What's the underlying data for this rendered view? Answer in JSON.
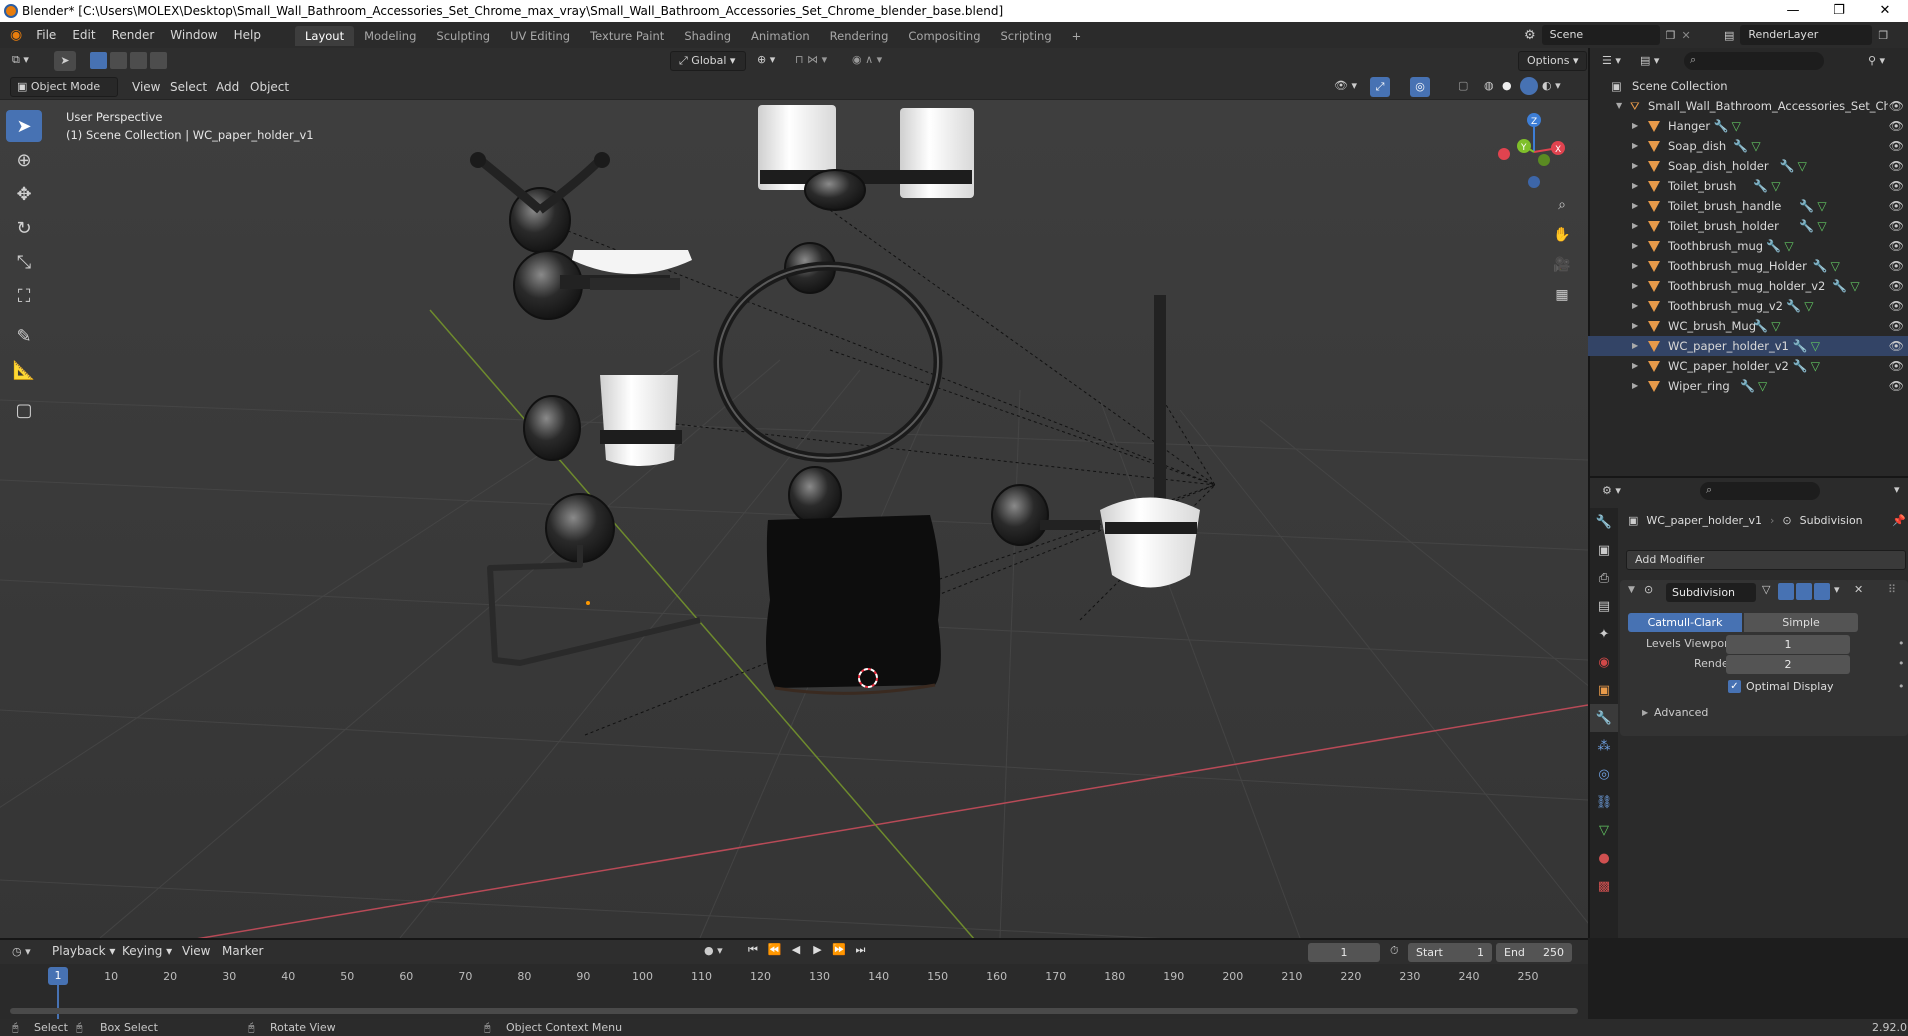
{
  "window": {
    "title": "Blender* [C:\\Users\\MOLEX\\Desktop\\Small_Wall_Bathroom_Accessories_Set_Chrome_max_vray\\Small_Wall_Bathroom_Accessories_Set_Chrome_blender_base.blend]",
    "minimize": "—",
    "restore": "❐",
    "close": "✕"
  },
  "menu": [
    "File",
    "Edit",
    "Render",
    "Window",
    "Help"
  ],
  "workspaces": [
    "Layout",
    "Modeling",
    "Sculpting",
    "UV Editing",
    "Texture Paint",
    "Shading",
    "Animation",
    "Rendering",
    "Compositing",
    "Scripting"
  ],
  "workspace_add": "+",
  "scene": "Scene",
  "view_layer": "RenderLayer",
  "header": {
    "transform_orientation": "Global",
    "options": "Options"
  },
  "viewport_header": {
    "mode": "Object Mode",
    "menus": [
      "View",
      "Select",
      "Add",
      "Object"
    ]
  },
  "viewport": {
    "perspective_label": "User Perspective",
    "collection_label": "(1) Scene Collection | WC_paper_holder_v1",
    "gizmo": {
      "z": "Z",
      "y": "Y",
      "x": "X"
    }
  },
  "outliner": {
    "root": "Scene Collection",
    "collection": "Small_Wall_Bathroom_Accessories_Set_Chro",
    "items": [
      {
        "name": "Hanger",
        "selected": false
      },
      {
        "name": "Soap_dish",
        "selected": false
      },
      {
        "name": "Soap_dish_holder",
        "selected": false
      },
      {
        "name": "Toilet_brush",
        "selected": false
      },
      {
        "name": "Toilet_brush_handle",
        "selected": false
      },
      {
        "name": "Toilet_brush_holder",
        "selected": false
      },
      {
        "name": "Toothbrush_mug",
        "selected": false
      },
      {
        "name": "Toothbrush_mug_Holder",
        "selected": false
      },
      {
        "name": "Toothbrush_mug_holder_v2",
        "selected": false
      },
      {
        "name": "Toothbrush_mug_v2",
        "selected": false
      },
      {
        "name": "WC_brush_Mug",
        "selected": false
      },
      {
        "name": "WC_paper_holder_v1",
        "selected": true
      },
      {
        "name": "WC_paper_holder_v2",
        "selected": false
      },
      {
        "name": "Wiper_ring",
        "selected": false
      }
    ]
  },
  "properties": {
    "object_name": "WC_paper_holder_v1",
    "modifier_crumb": "Subdivision",
    "add_modifier": "Add Modifier",
    "modifier": {
      "name": "Subdivision",
      "types": [
        "Catmull-Clark",
        "Simple"
      ],
      "active_type": "Catmull-Clark",
      "levels_viewport_label": "Levels Viewport",
      "levels_viewport": "1",
      "render_label": "Render",
      "render": "2",
      "optimal_display_label": "Optimal Display",
      "optimal_display": true,
      "advanced_label": "Advanced"
    }
  },
  "timeline": {
    "menus": [
      "Playback",
      "Keying",
      "View",
      "Marker"
    ],
    "current_frame": "1",
    "start_label": "Start",
    "start": "1",
    "end_label": "End",
    "end": "250",
    "ticks": [
      "1",
      "10",
      "20",
      "30",
      "40",
      "50",
      "60",
      "70",
      "80",
      "90",
      "100",
      "110",
      "120",
      "130",
      "140",
      "150",
      "160",
      "170",
      "180",
      "190",
      "200",
      "210",
      "220",
      "230",
      "240",
      "250"
    ]
  },
  "statusbar": {
    "select": "Select",
    "box_select": "Box Select",
    "rotate_view": "Rotate View",
    "context_menu": "Object Context Menu",
    "version": "2.92.0"
  },
  "colors": {
    "accent": "#4772b3",
    "x_axis": "#e0434f",
    "y_axis": "#7fbf2a",
    "z_axis": "#3d7ed6",
    "mesh_icon": "#e89a4a"
  }
}
